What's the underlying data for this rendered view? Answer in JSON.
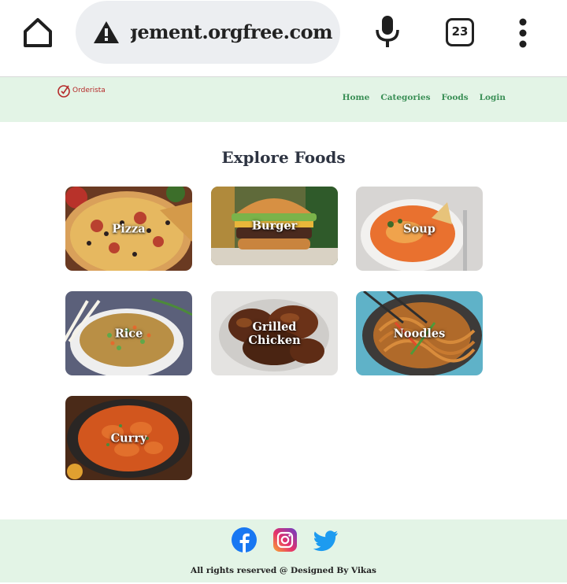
{
  "browser": {
    "url": "management.orgfree.com",
    "tab_count": "23",
    "icons": [
      "home-icon",
      "warning-icon",
      "microphone-icon",
      "tab-switcher-icon",
      "more-options-icon"
    ]
  },
  "header": {
    "logo_text": "Orderista",
    "nav": [
      "Home",
      "Categories",
      "Foods",
      "Login"
    ]
  },
  "main": {
    "title": "Explore Foods",
    "foods": [
      "Pizza",
      "Burger",
      "Soup",
      "Rice",
      "Grilled\nChicken",
      "Noodles",
      "Curry"
    ]
  },
  "footer": {
    "social": [
      "facebook-icon",
      "instagram-icon",
      "twitter-icon"
    ],
    "copyright": "All rights reserved @ Designed By Vikas"
  },
  "colors": {
    "header_bg": "#e3f4e6",
    "nav_link": "#3a8f56",
    "title": "#2e3442",
    "logo": "#b52a2a"
  }
}
